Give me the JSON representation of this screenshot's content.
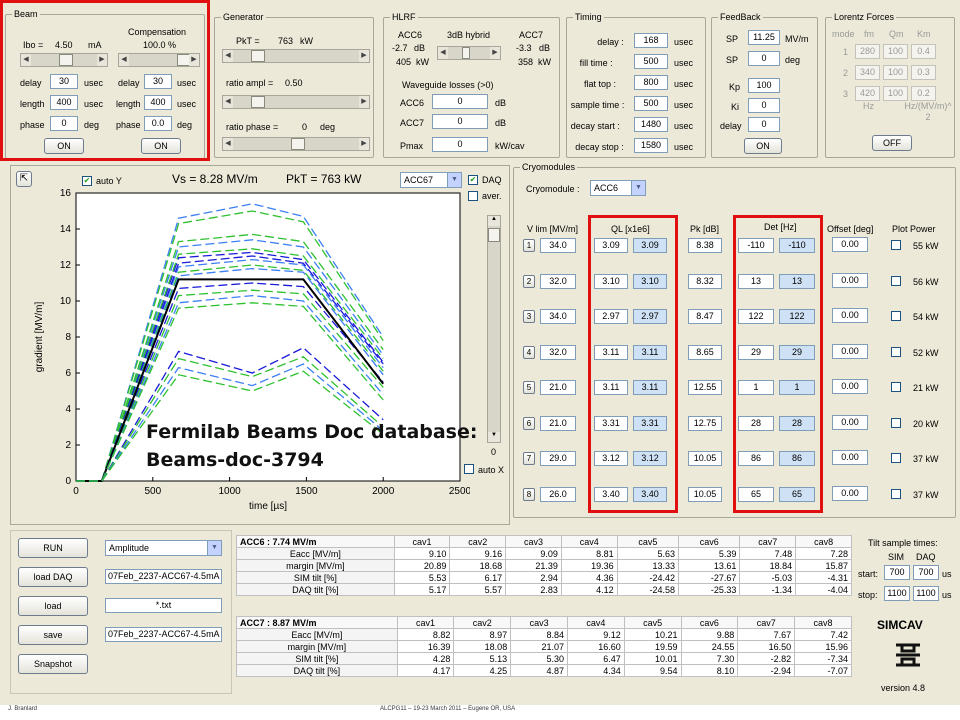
{
  "beam": {
    "title": "Beam",
    "ibo_label": "Ibo =",
    "ibo_value": "4.50",
    "ibo_unit": "mA",
    "comp_label": "Compensation",
    "comp_value": "100.0 %",
    "delay_label": "delay",
    "length_label": "length",
    "phase_label": "phase",
    "usec": "usec",
    "deg": "deg",
    "delay": "30",
    "length": "400",
    "phase": "0",
    "comp_delay": "30",
    "comp_length": "400",
    "comp_phase": "0.0",
    "on": "ON",
    "comp_on": "ON"
  },
  "generator": {
    "title": "Generator",
    "pkt_label": "PkT =",
    "pkt_value": "763",
    "pkt_unit": "kW",
    "ratio_ampl_label": "ratio ampl =",
    "ratio_ampl_value": "0.50",
    "ratio_phase_label": "ratio phase =",
    "ratio_phase_value": "0",
    "ratio_phase_unit": "deg"
  },
  "hlrf": {
    "title": "HLRF",
    "acc6": "ACC6",
    "acc6_db": "-2.7",
    "acc6_kw": "405",
    "hybrid": "3dB hybrid",
    "acc7": "ACC7",
    "acc7_db": "-3.3",
    "acc7_kw": "358",
    "db": "dB",
    "kw": "kW",
    "wg_label": "Waveguide losses (>0)",
    "wg_acc6_label": "ACC6",
    "wg_acc7_label": "ACC7",
    "wg_acc6": "0",
    "wg_acc7": "0",
    "pmax_label": "Pmax",
    "pmax": "0",
    "pmax_unit": "kW/cav"
  },
  "timing": {
    "title": "Timing",
    "usec": "usec",
    "rows": [
      {
        "label": "delay :",
        "value": "168"
      },
      {
        "label": "fill time :",
        "value": "500"
      },
      {
        "label": "flat top :",
        "value": "800"
      },
      {
        "label": "sample time :",
        "value": "500"
      },
      {
        "label": "decay start :",
        "value": "1480"
      },
      {
        "label": "decay stop :",
        "value": "1580"
      }
    ]
  },
  "feedback": {
    "title": "FeedBack",
    "sp1_label": "SP",
    "sp1": "11.25",
    "sp1_unit": "MV/m",
    "sp2_label": "SP",
    "sp2": "0",
    "sp2_unit": "deg",
    "kp_label": "Kp",
    "kp": "100",
    "ki_label": "Ki",
    "ki": "0",
    "delay_label": "delay",
    "delay": "0",
    "on": "ON"
  },
  "lorentz": {
    "title": "Lorentz Forces",
    "mode_label": "mode",
    "fm_label": "fm",
    "qm_label": "Qm",
    "km_label": "Km",
    "rows": [
      {
        "mode": "1",
        "fm": "280",
        "qm": "100",
        "km": "0.4"
      },
      {
        "mode": "2",
        "fm": "340",
        "qm": "100",
        "km": "0.3"
      },
      {
        "mode": "3",
        "fm": "420",
        "qm": "100",
        "km": "0.2"
      }
    ],
    "hz": "Hz",
    "km_unit": "Hz/(MV/m)^2",
    "off": "OFF"
  },
  "plot": {
    "autoy": "auto Y",
    "vs_label": "Vs = 8.28 MV/m",
    "pkt_label": "PkT = 763 kW",
    "acc_select": "ACC67",
    "daq": "DAQ",
    "aver": "aver.",
    "autox": "auto X",
    "slider_zero": "0"
  },
  "overlay": {
    "line1": "Fermilab Beams Doc database:",
    "line2": "Beams-doc-3794"
  },
  "cryo": {
    "title": "Cryomodules",
    "module_label": "Cryomodule :",
    "module": "ACC6",
    "vlim_label": "V lim  [MV/m]",
    "ql_label": "QL [x1e6]",
    "pk_label": "Pk  [dB]",
    "det_label": "Det  [Hz]",
    "offset_label": "Offset  [deg]",
    "plot_power_label": "Plot Power",
    "rows": [
      {
        "n": "1",
        "vlim": "34.0",
        "ql": "3.09",
        "ql2": "3.09",
        "pk": "8.38",
        "det": "-110",
        "det2": "-110",
        "offset": "0.00",
        "power": "55 kW"
      },
      {
        "n": "2",
        "vlim": "32.0",
        "ql": "3.10",
        "ql2": "3.10",
        "pk": "8.32",
        "det": "13",
        "det2": "13",
        "offset": "0.00",
        "power": "56 kW"
      },
      {
        "n": "3",
        "vlim": "34.0",
        "ql": "2.97",
        "ql2": "2.97",
        "pk": "8.47",
        "det": "122",
        "det2": "122",
        "offset": "0.00",
        "power": "54 kW"
      },
      {
        "n": "4",
        "vlim": "32.0",
        "ql": "3.11",
        "ql2": "3.11",
        "pk": "8.65",
        "det": "29",
        "det2": "29",
        "offset": "0.00",
        "power": "52 kW"
      },
      {
        "n": "5",
        "vlim": "21.0",
        "ql": "3.11",
        "ql2": "3.11",
        "pk": "12.55",
        "det": "1",
        "det2": "1",
        "offset": "0.00",
        "power": "21 kW"
      },
      {
        "n": "6",
        "vlim": "21.0",
        "ql": "3.31",
        "ql2": "3.31",
        "pk": "12.75",
        "det": "28",
        "det2": "28",
        "offset": "0.00",
        "power": "20 kW"
      },
      {
        "n": "7",
        "vlim": "29.0",
        "ql": "3.12",
        "ql2": "3.12",
        "pk": "10.05",
        "det": "86",
        "det2": "86",
        "offset": "0.00",
        "power": "37 kW"
      },
      {
        "n": "8",
        "vlim": "26.0",
        "ql": "3.40",
        "ql2": "3.40",
        "pk": "10.05",
        "det": "65",
        "det2": "65",
        "offset": "0.00",
        "power": "37 kW"
      }
    ]
  },
  "controls": {
    "run": "RUN",
    "load_daq": "load DAQ",
    "load": "load",
    "save": "save",
    "snapshot": "Snapshot",
    "amplitude": "Amplitude",
    "file1": "07Feb_2237-ACC67-4.5mA",
    "pattern": "*.txt",
    "file2": "07Feb_2237-ACC67-4.5mA"
  },
  "acc6_table": {
    "header": "ACC6 :  7.74 MV/m",
    "cols": [
      "cav1",
      "cav2",
      "cav3",
      "cav4",
      "cav5",
      "cav6",
      "cav7",
      "cav8"
    ],
    "rows": [
      {
        "label": "Eacc [MV/m]",
        "values": [
          "9.10",
          "9.16",
          "9.09",
          "8.81",
          "5.63",
          "5.39",
          "7.48",
          "7.28"
        ]
      },
      {
        "label": "margin [MV/m]",
        "values": [
          "20.89",
          "18.68",
          "21.39",
          "19.36",
          "13.33",
          "13.61",
          "18.84",
          "15.87"
        ]
      },
      {
        "label": "SIM tilt [%]",
        "values": [
          "5.53",
          "6.17",
          "2.94",
          "4.36",
          "-24.42",
          "-27.67",
          "-5.03",
          "-4.31"
        ]
      },
      {
        "label": "DAQ tilt [%]",
        "values": [
          "5.17",
          "5.57",
          "2.83",
          "4.12",
          "-24.58",
          "-25.33",
          "-1.34",
          "-4.04"
        ]
      }
    ]
  },
  "acc7_table": {
    "header": "ACC7 :  8.87 MV/m",
    "cols": [
      "cav1",
      "cav2",
      "cav3",
      "cav4",
      "cav5",
      "cav6",
      "cav7",
      "cav8"
    ],
    "rows": [
      {
        "label": "Eacc [MV/m]",
        "values": [
          "8.82",
          "8.97",
          "8.84",
          "9.12",
          "10.21",
          "9.88",
          "7.67",
          "7.42"
        ]
      },
      {
        "label": "margin [MV/m]",
        "values": [
          "16.39",
          "18.08",
          "21.07",
          "16.60",
          "19.59",
          "24.55",
          "16.50",
          "15.96"
        ]
      },
      {
        "label": "SIM tilt [%]",
        "values": [
          "4.28",
          "5.13",
          "5.30",
          "6.47",
          "10.01",
          "7.30",
          "-2.82",
          "-7.34"
        ]
      },
      {
        "label": "DAQ tilt [%]",
        "values": [
          "4.17",
          "4.25",
          "4.87",
          "4.34",
          "9.54",
          "8.10",
          "-2.94",
          "-7.07"
        ]
      }
    ]
  },
  "tilt": {
    "title": "Tilt sample times:",
    "sim": "SIM",
    "daq": "DAQ",
    "start_label": "start:",
    "stop_label": "stop:",
    "start_sim": "700",
    "start_daq": "700",
    "stop_sim": "1100",
    "stop_daq": "1100",
    "unit": "us"
  },
  "brand": {
    "name": "SIMCAV",
    "version": "version 4.8"
  },
  "footer": {
    "left": "J. Branlard",
    "center": "ALCPG11 – 19-23 March 2011 – Eugene OR, USA"
  },
  "chart_data": {
    "type": "line",
    "xlabel": "time [µs]",
    "ylabel": "gradient [MV/m]",
    "xlim": [
      0,
      2500
    ],
    "ylim": [
      0,
      16
    ],
    "xticks": [
      0,
      500,
      1000,
      1500,
      2000,
      2500
    ],
    "yticks": [
      0,
      2,
      4,
      6,
      8,
      10,
      12,
      14,
      16
    ],
    "x": [
      0,
      168,
      668,
      1148,
      1480,
      2000
    ],
    "series": [
      {
        "color": "#3d7ff5",
        "dash": true,
        "values": [
          0,
          0,
          13.0,
          13.4,
          13.0,
          7.0
        ]
      },
      {
        "color": "#2fc12f",
        "dash": true,
        "values": [
          0,
          0,
          13.3,
          13.7,
          13.3,
          7.3
        ]
      },
      {
        "color": "#3d7ff5",
        "dash": true,
        "values": [
          0,
          0,
          14.6,
          15.4,
          14.7,
          8.0
        ]
      },
      {
        "color": "#2fc12f",
        "dash": true,
        "values": [
          0,
          0,
          14.3,
          15.0,
          14.4,
          7.8
        ]
      },
      {
        "color": "#1a1ad8",
        "dash": true,
        "values": [
          0,
          0,
          12.4,
          12.7,
          12.3,
          6.6
        ]
      },
      {
        "color": "#2fc12f",
        "dash": true,
        "values": [
          0,
          0,
          12.6,
          12.9,
          12.5,
          6.8
        ]
      },
      {
        "color": "#3d7ff5",
        "dash": true,
        "values": [
          0,
          0,
          11.9,
          12.3,
          12.0,
          6.3
        ]
      },
      {
        "color": "#1a1ad8",
        "dash": true,
        "values": [
          0,
          0,
          12.1,
          12.5,
          12.1,
          6.5
        ]
      },
      {
        "color": "#2fc12f",
        "dash": true,
        "values": [
          0,
          0,
          11.6,
          12.0,
          11.7,
          6.1
        ]
      },
      {
        "color": "#3d7ff5",
        "dash": true,
        "values": [
          0,
          0,
          11.4,
          11.8,
          11.6,
          5.9
        ]
      },
      {
        "color": "#1a1ad8",
        "dash": true,
        "values": [
          0,
          0,
          10.7,
          11.0,
          10.8,
          5.5
        ]
      },
      {
        "color": "#2fc12f",
        "dash": true,
        "values": [
          0,
          0,
          10.3,
          10.6,
          10.4,
          5.2
        ]
      },
      {
        "color": "#000000",
        "dash": false,
        "values": [
          0,
          0,
          11.2,
          11.2,
          11.2,
          5.4
        ]
      },
      {
        "color": "#3d7ff5",
        "dash": true,
        "values": [
          0,
          0,
          9.9,
          10.3,
          10.0,
          4.8
        ]
      },
      {
        "color": "#2fc12f",
        "dash": true,
        "values": [
          0,
          0,
          9.6,
          9.9,
          9.7,
          4.5
        ]
      },
      {
        "color": "#1a1ad8",
        "dash": true,
        "values": [
          0,
          0,
          7.2,
          6.0,
          7.4,
          3.4
        ]
      },
      {
        "color": "#2fc12f",
        "dash": true,
        "values": [
          0,
          0,
          6.8,
          5.8,
          6.9,
          3.0
        ]
      },
      {
        "color": "#3d7ff5",
        "dash": true,
        "values": [
          0,
          0,
          6.3,
          5.3,
          6.5,
          2.8
        ]
      },
      {
        "color": "#2fc12f",
        "dash": true,
        "values": [
          0,
          0,
          5.9,
          5.0,
          6.1,
          2.6
        ]
      }
    ]
  }
}
